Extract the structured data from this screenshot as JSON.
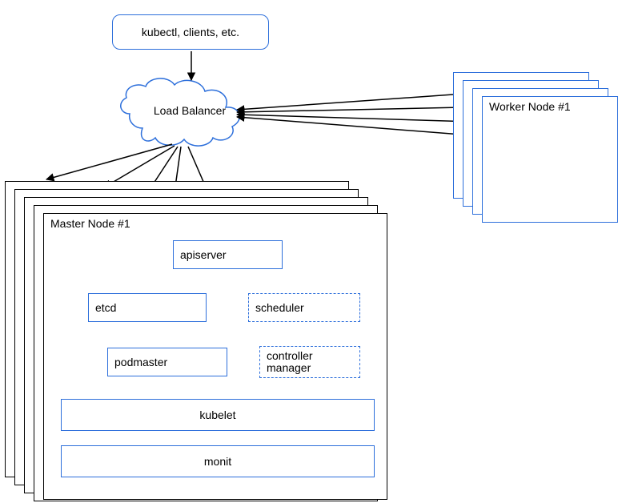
{
  "clients_box": {
    "label": "kubectl, clients, etc."
  },
  "load_balancer": {
    "label": "Load Balancer"
  },
  "master_stack": {
    "title": "Master Node #1",
    "components": {
      "apiserver": "apiserver",
      "etcd": "etcd",
      "scheduler": "scheduler",
      "podmaster": "podmaster",
      "controller_manager_l1": "controller",
      "controller_manager_l2": "manager",
      "kubelet": "kubelet",
      "monit": "monit"
    }
  },
  "worker_stack": {
    "title": "Worker Node #1"
  },
  "colors": {
    "blue": "#2d6fdb",
    "blue_fill": "#3b82f6",
    "black": "#000000",
    "grey": "#888888"
  }
}
